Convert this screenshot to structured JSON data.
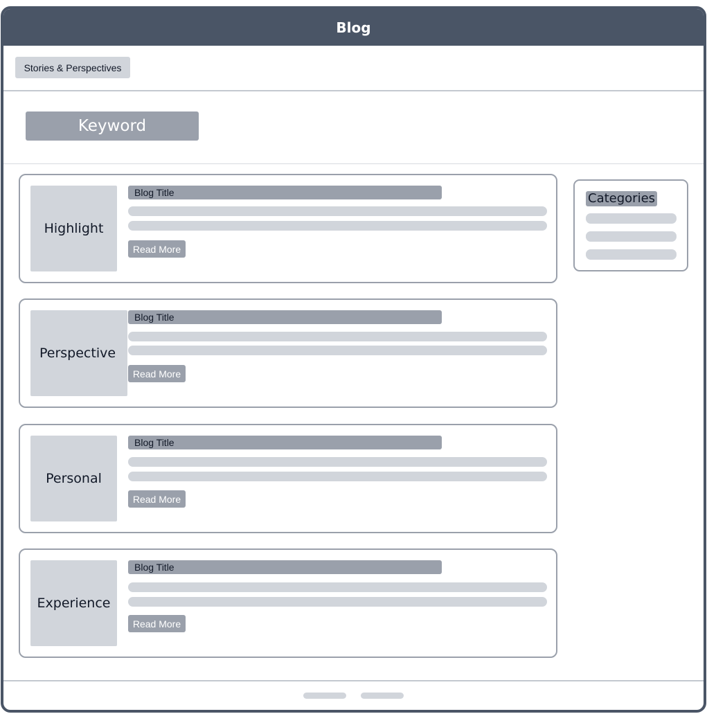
{
  "window": {
    "title": "Blog"
  },
  "nav": {
    "tab_label": "Stories & Perspectives"
  },
  "search": {
    "placeholder": "Keyword"
  },
  "posts": [
    {
      "category": "Highlight",
      "title": "Blog Title",
      "read_more": "Read More"
    },
    {
      "category": "Perspective",
      "title": "Blog Title",
      "read_more": "Read More"
    },
    {
      "category": "Personal",
      "title": "Blog Title",
      "read_more": "Read More"
    },
    {
      "category": "Experience",
      "title": "Blog Title",
      "read_more": "Read More"
    }
  ],
  "sidebar": {
    "title": "Categories"
  },
  "colors": {
    "header": "#4a5566",
    "accent_gray": "#9aa0ab",
    "placeholder_gray": "#d1d5db"
  }
}
